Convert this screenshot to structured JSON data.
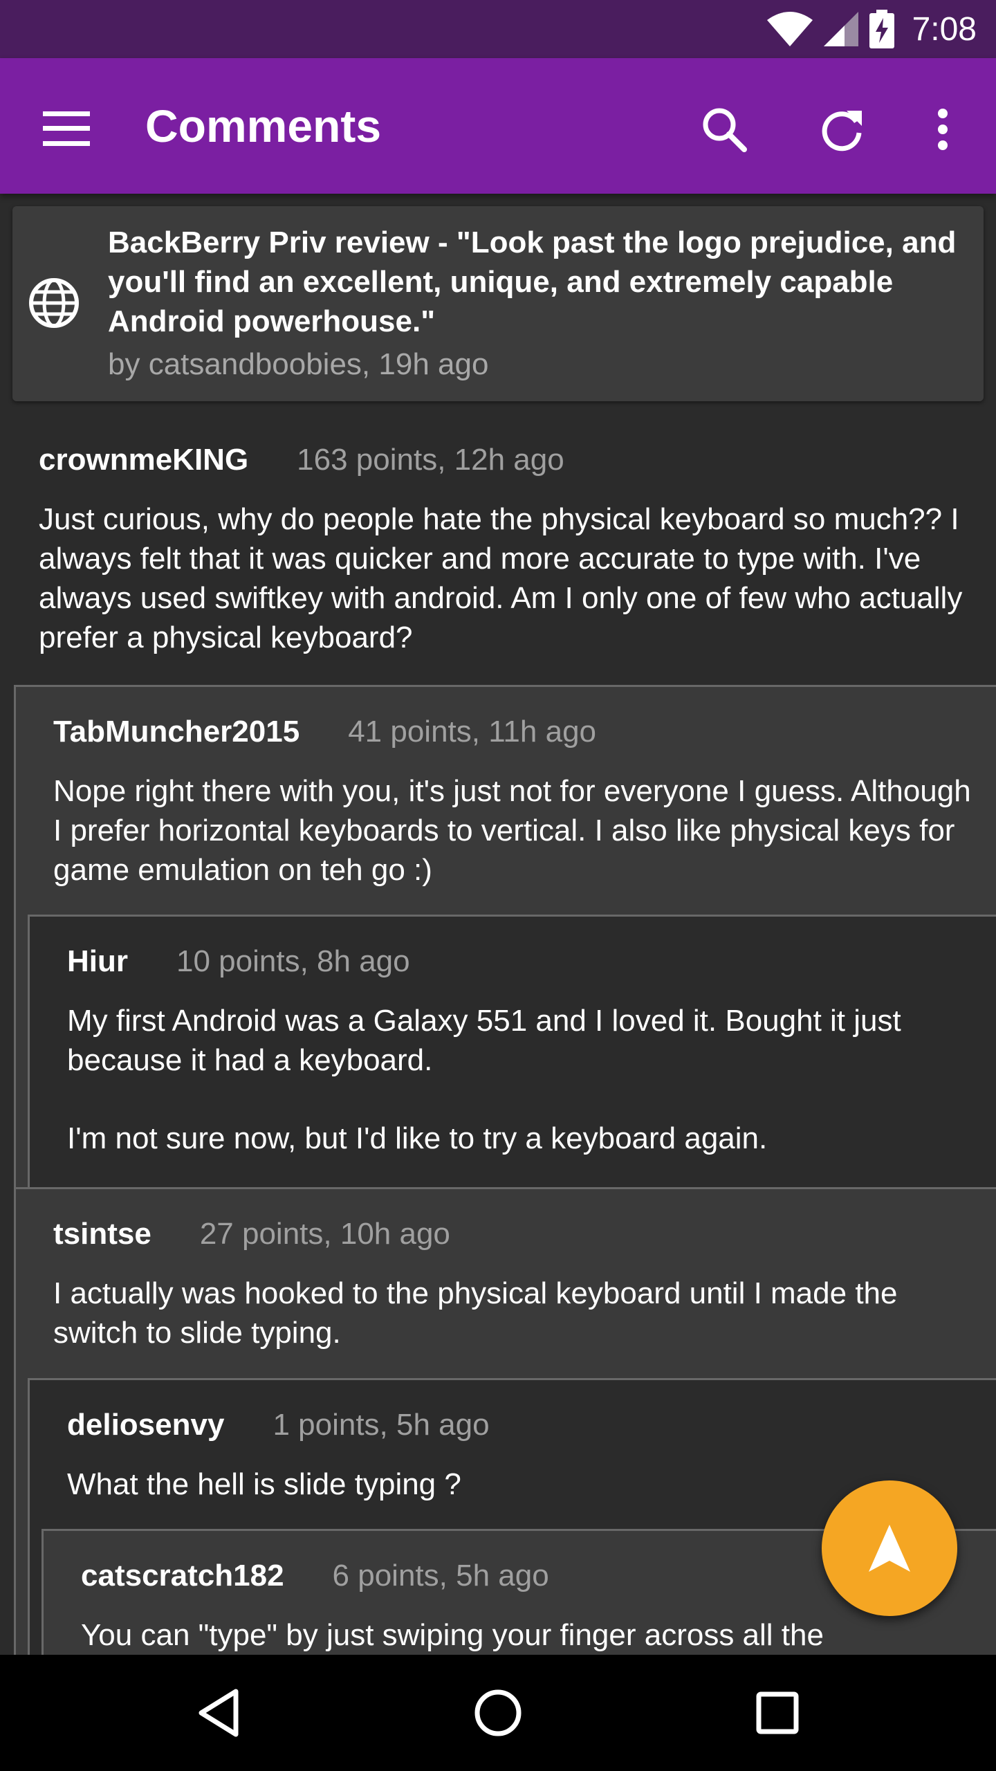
{
  "status_bar": {
    "time": "7:08",
    "icons": [
      "wifi-icon",
      "cell-signal-icon",
      "battery-charging-icon"
    ]
  },
  "app_bar": {
    "title": "Comments",
    "menu_icon": "hamburger-menu-icon",
    "actions": [
      "search-icon",
      "refresh-icon",
      "more-vert-icon"
    ]
  },
  "post": {
    "title": "BackBerry Priv review - \"Look past the logo prejudice, and you'll find an excellent, unique, and extremely capable Android powerhouse.\"",
    "meta": "by catsandboobies, 19h ago",
    "icon": "globe-icon"
  },
  "comments": [
    {
      "author": "crownmeKING",
      "meta": "163 points, 12h ago",
      "body": "Just curious, why do people hate the physical keyboard so much?? I always felt that it was quicker and more accurate to type with. I've always used swiftkey with android. Am I only one of few who actually prefer a physical keyboard?"
    },
    {
      "author": "TabMuncher2015",
      "meta": "41 points, 11h ago",
      "body": "Nope right there with you, it's just not for everyone I guess. Although I prefer horizontal keyboards to vertical. I also like physical keys for game emulation on teh go :)"
    },
    {
      "author": "Hiur",
      "meta": "10 points, 8h ago",
      "body": "My first Android was a Galaxy 551 and I loved it. Bought it just because it had a keyboard.",
      "body2": "I'm not sure now, but I'd like to try a keyboard again."
    },
    {
      "author": "tsintse",
      "meta": "27 points, 10h ago",
      "body": "I actually was hooked to the physical keyboard until I made the switch to slide typing."
    },
    {
      "author": "deliosenvy",
      "meta": "1 points, 5h ago",
      "body": "What the hell is slide typing ?"
    },
    {
      "author": "catscratch182",
      "meta": "6 points, 5h ago",
      "body": "You can \"type\" by just swiping your finger across all the"
    }
  ],
  "fab": {
    "icon": "navigation-arrow-icon"
  },
  "nav_bar": {
    "icons": [
      "back-icon",
      "home-icon",
      "recents-icon"
    ]
  },
  "colors": {
    "status_bar": "#4a1d5e",
    "app_bar": "#7b1fa2",
    "fab": "#f5a623",
    "background": "#2b2b2b"
  }
}
